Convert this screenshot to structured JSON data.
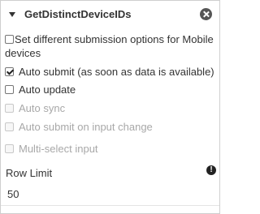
{
  "panel": {
    "title": "GetDistinctDeviceIDs",
    "caret_icon": "caret-down-icon",
    "close_icon": "close-circle-icon"
  },
  "options": [
    {
      "label": "Set different submission options for Mobile devices",
      "checked": false,
      "disabled": false
    },
    {
      "label": "Auto submit (as soon as data is available)",
      "checked": true,
      "disabled": false
    },
    {
      "label": "Auto update",
      "checked": false,
      "disabled": false
    },
    {
      "label": "Auto sync",
      "checked": false,
      "disabled": true
    },
    {
      "label": "Auto submit on input change",
      "checked": false,
      "disabled": true
    },
    {
      "label": "Multi-select input",
      "checked": false,
      "disabled": true
    }
  ],
  "row_limit": {
    "label": "Row Limit",
    "value": "50",
    "info_icon": "info-circle-icon",
    "info_glyph": "!"
  }
}
